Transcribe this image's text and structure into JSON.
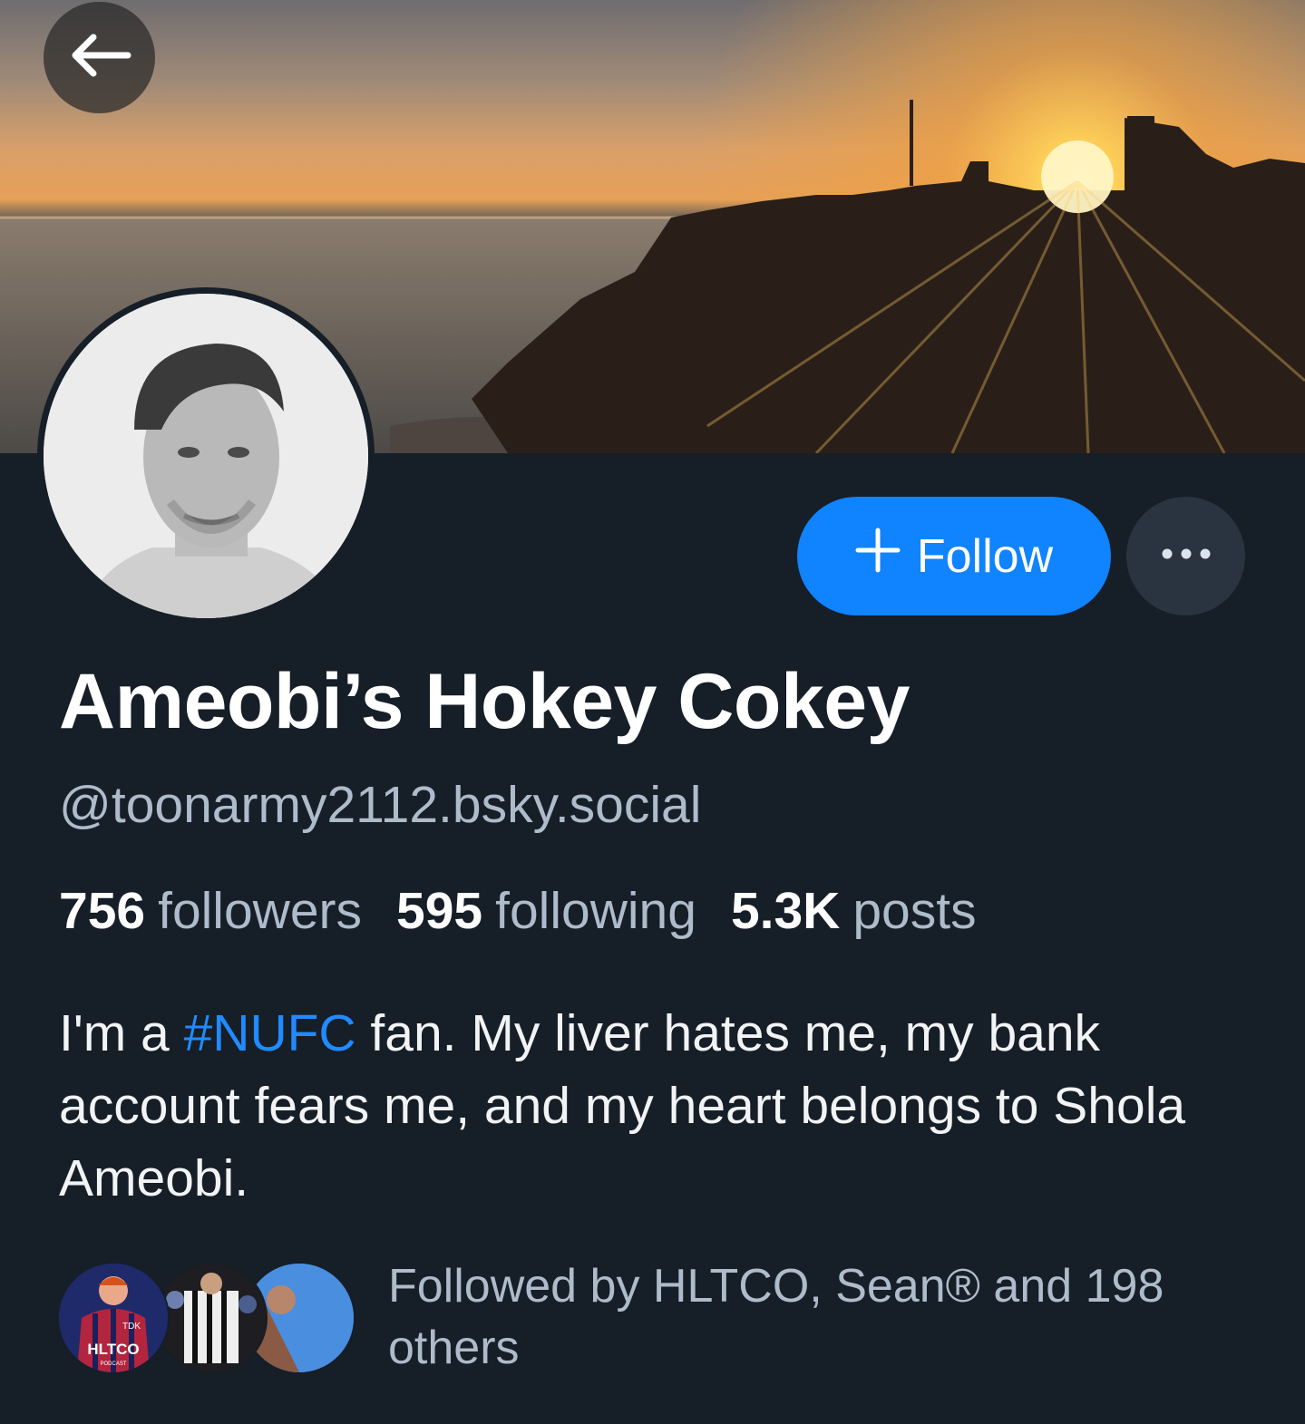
{
  "profile": {
    "display_name": "Ameobi’s Hokey Cokey",
    "handle": "@toonarmy2112.bsky.social",
    "stats": {
      "followers_count": "756",
      "followers_label": "followers",
      "following_count": "595",
      "following_label": "following",
      "posts_count": "5.3K",
      "posts_label": "posts"
    },
    "bio": {
      "before": "I'm a ",
      "hashtag": "#NUFC",
      "after": " fan. My liver hates me, my bank account fears me, and my heart belongs to Shola Ameobi."
    },
    "followed_by": "Followed by HLTCO, Sean® and 198 others",
    "known_followers": [
      {
        "avatar_text": "HLTCO",
        "avatar_subtext": "PODCAST",
        "avatar_badge": "TDK"
      },
      {
        "avatar_text": ""
      },
      {
        "avatar_text": ""
      }
    ]
  },
  "actions": {
    "follow_icon": "plus-icon",
    "follow_label": "Follow",
    "more_icon": "ellipsis-icon",
    "back_icon": "arrow-left-icon"
  },
  "colors": {
    "background": "#161e27",
    "accent": "#1083fe",
    "hashtag": "#208bfe",
    "muted_text": "#aebbca",
    "secondary_button": "#2a3440"
  }
}
